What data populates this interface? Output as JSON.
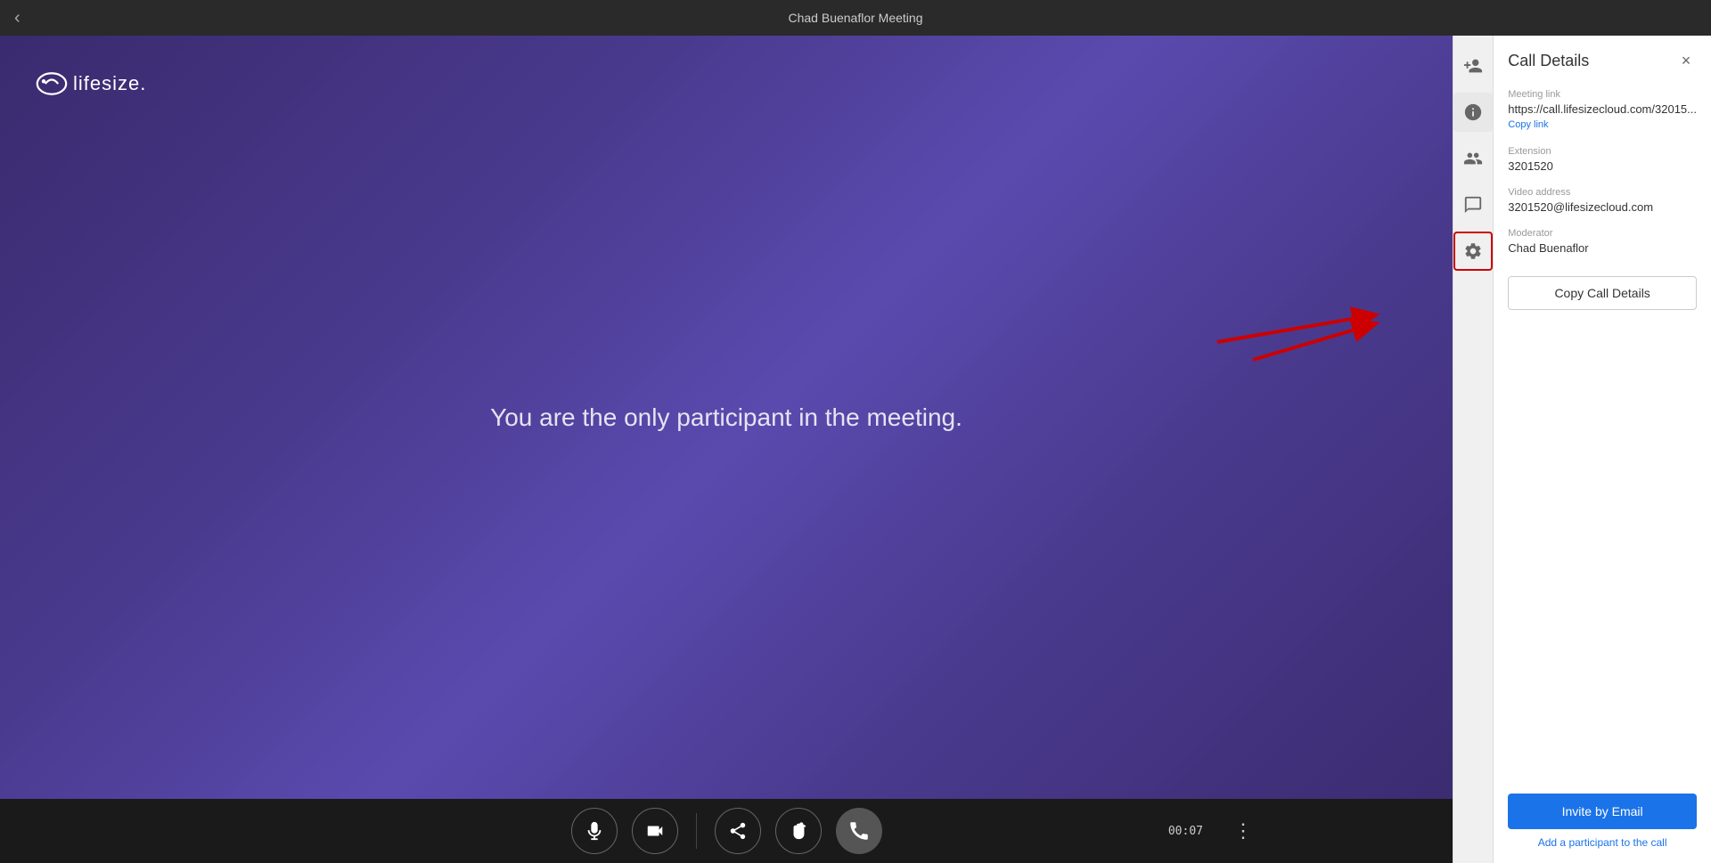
{
  "topbar": {
    "title": "Chad Buenaflor Meeting",
    "back_icon": "‹"
  },
  "video": {
    "logo_text": "lifesize.",
    "message": "You are the only participant in the meeting."
  },
  "controls": {
    "timer": "00:07",
    "microphone_label": "microphone",
    "camera_label": "camera",
    "share_label": "share",
    "hand_label": "hand",
    "end_call_label": "end call",
    "more_label": "more options"
  },
  "sidebar": {
    "title": "Call Details",
    "close_label": "×",
    "meeting_link_label": "Meeting link",
    "meeting_link_value": "https://call.lifesizecloud.com/32015...",
    "copy_link_label": "Copy link",
    "extension_label": "Extension",
    "extension_value": "3201520",
    "video_address_label": "Video address",
    "video_address_value": "3201520@lifesizecloud.com",
    "moderator_label": "Moderator",
    "moderator_value": "Chad Buenaflor",
    "copy_call_details_label": "Copy Call Details",
    "invite_email_label": "Invite by Email",
    "add_participant_label": "Add a participant to the call",
    "nav_icons": [
      "person-add",
      "info",
      "people",
      "chat"
    ],
    "settings_icon": "settings"
  }
}
